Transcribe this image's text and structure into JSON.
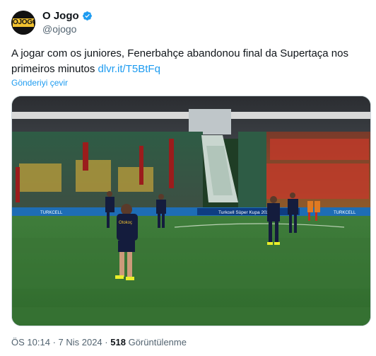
{
  "author": {
    "display_name": "O Jogo",
    "handle": "@ojogo",
    "avatar_text": "OJOGO",
    "verified": true
  },
  "tweet": {
    "text": "A jogar com os juniores, Fenerbahçe abandonou final da Supertaça nos primeiros minutos",
    "link": "dlvr.it/T5BtFq",
    "translate_label": "Gönderiyi çevir"
  },
  "media": {
    "board_left": "TURKCELL",
    "board_center": "Turkcell Süper Kupa 2024",
    "board_right": "TURKCELL",
    "shirt_sponsor": "Otokoç"
  },
  "meta": {
    "time": "ÖS 10:14",
    "date": "7 Nis 2024",
    "views": "518",
    "views_label": "Görüntülenme"
  },
  "colors": {
    "link": "#1d9bf0",
    "secondary": "#536471",
    "verified": "#1d9bf0",
    "badge": "#f2c230"
  }
}
